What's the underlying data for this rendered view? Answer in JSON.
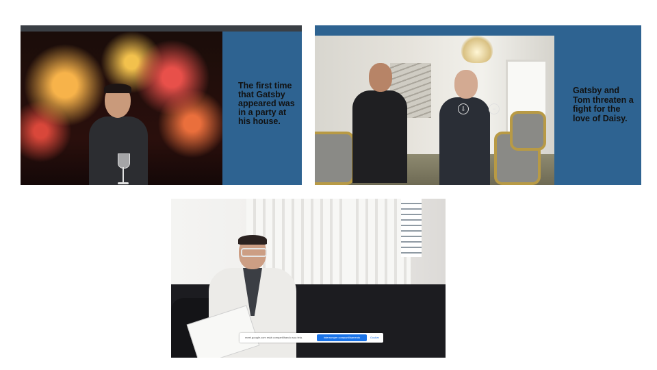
{
  "slides": [
    {
      "caption": "The first time that Gatsby appeared was in a party at his house."
    },
    {
      "caption": "Gatsby and Tom threaten a fight for the love of Daisy.",
      "overlay_icons": [
        "pin-icon",
        "minus-circle-icon"
      ]
    },
    {
      "share_bar": {
        "message": "meet.google.com está compartilhando sua tela.",
        "stop_label": "Interromper compartilhamento",
        "hide_label": "Ocultar"
      }
    }
  ],
  "colors": {
    "slide_blue": "#2e6391",
    "share_button": "#1a73e8"
  }
}
